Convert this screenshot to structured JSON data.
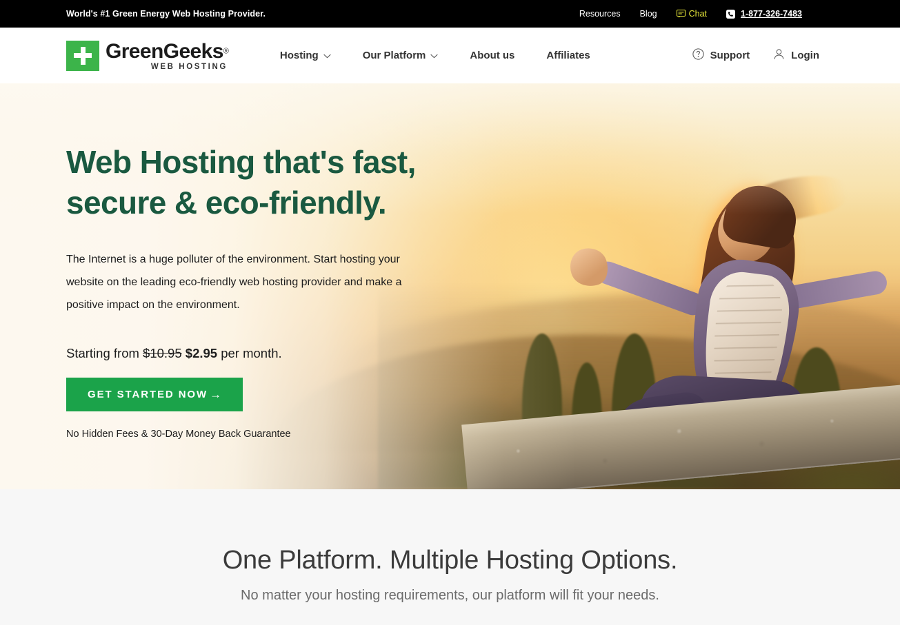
{
  "topbar": {
    "tagline": "World's #1 Green Energy Web Hosting Provider.",
    "resources_label": "Resources",
    "blog_label": "Blog",
    "chat_label": "Chat",
    "chat_icon": "chat-bubble-icon",
    "phone_icon": "phone-icon",
    "phone_number": "1-877-326-7483",
    "chat_color": "#e9e93a",
    "background": "#000000"
  },
  "header": {
    "logo": {
      "mark_icon": "plus-square-icon",
      "word": "GreenGeeks",
      "registered": "®",
      "sub": "WEB HOSTING",
      "mark_color": "#3cb44a"
    },
    "nav": [
      {
        "label": "Hosting",
        "has_dropdown": true,
        "icon": "chevron-down-icon"
      },
      {
        "label": "Our Platform",
        "has_dropdown": true,
        "icon": "chevron-down-icon"
      },
      {
        "label": "About us",
        "has_dropdown": false
      },
      {
        "label": "Affiliates",
        "has_dropdown": false
      }
    ],
    "support_label": "Support",
    "support_icon": "question-circle-icon",
    "login_label": "Login",
    "login_icon": "user-icon"
  },
  "hero": {
    "title_line1": "Web Hosting that's fast,",
    "title_line2": "secure & eco-friendly.",
    "title_color": "#1a5940",
    "description": "The Internet is a huge polluter of the environment. Start hosting your website on the leading eco-friendly web hosting provider and make a positive impact on the environment.",
    "price_prefix": "Starting from",
    "price_old": "$10.95",
    "price_new": "$2.95",
    "price_suffix": "per month.",
    "cta_label": "GET STARTED NOW",
    "cta_arrow": "→",
    "cta_color": "#1ba34a",
    "note": "No Hidden Fees & 30-Day Money Back Guarantee"
  },
  "platform": {
    "title": "One Platform. Multiple Hosting Options.",
    "subtitle": "No matter your hosting requirements, our platform will fit your needs.",
    "background": "#f7f7f7"
  }
}
